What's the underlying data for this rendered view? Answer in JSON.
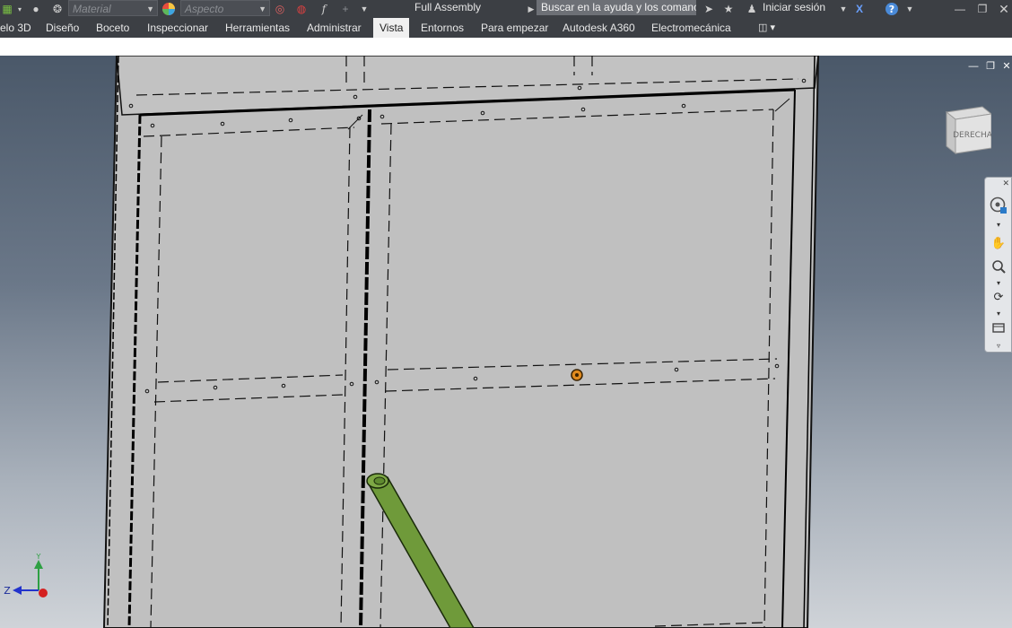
{
  "quick_access": {
    "material_placeholder": "Material",
    "appearance_placeholder": "Aspecto"
  },
  "window": {
    "title": "Full Assembly"
  },
  "search": {
    "placeholder": "Buscar en la ayuda y los comanc"
  },
  "account": {
    "signin_label": "Iniciar sesión"
  },
  "ribbon": {
    "tabs": [
      {
        "label": "elo 3D"
      },
      {
        "label": "Diseño"
      },
      {
        "label": "Boceto"
      },
      {
        "label": "Inspeccionar"
      },
      {
        "label": "Herramientas"
      },
      {
        "label": "Administrar"
      },
      {
        "label": "Vista",
        "active": true
      },
      {
        "label": "Entornos"
      },
      {
        "label": "Para empezar"
      },
      {
        "label": "Autodesk A360"
      },
      {
        "label": "Electromecánica"
      }
    ]
  },
  "viewcube": {
    "face_label": "DERECHA"
  },
  "triad": {
    "y_label": "Y",
    "z_label": "Z"
  },
  "colors": {
    "ui_dark": "#3c3f44",
    "model_panel": "#c0c0c0",
    "tube_green": "#6f9a3a",
    "point_orange": "#e08a1e",
    "axis_green": "#2ea043",
    "axis_blue": "#2233cc",
    "axis_red": "#d42020"
  },
  "icons": [
    "app-menu-icon",
    "material-icon",
    "appearance-icon",
    "formula-icon",
    "search-arrow-icon",
    "star-icon",
    "user-icon",
    "exchange-icon",
    "help-icon",
    "minimize-icon",
    "restore-icon",
    "close-icon",
    "steering-wheel-icon",
    "pan-icon",
    "zoom-icon",
    "orbit-icon",
    "look-at-icon"
  ]
}
